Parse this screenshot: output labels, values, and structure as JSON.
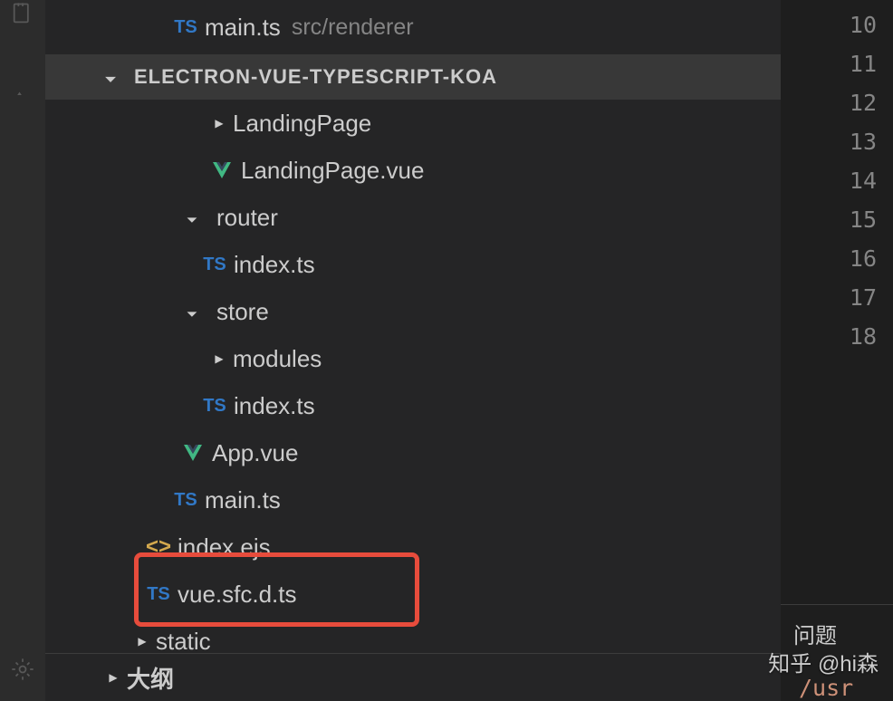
{
  "openEditors": {
    "file": {
      "icon": "TS",
      "name": "main.ts",
      "path": "src/renderer"
    }
  },
  "project": {
    "name": "ELECTRON-VUE-TYPESCRIPT-KOA"
  },
  "tree": [
    {
      "type": "folder",
      "expanded": false,
      "name": "LandingPage",
      "indent": 3
    },
    {
      "type": "file",
      "icon": "vue",
      "name": "LandingPage.vue",
      "indent": 3
    },
    {
      "type": "folder",
      "expanded": true,
      "name": "router",
      "indent": 2
    },
    {
      "type": "file",
      "icon": "TS",
      "name": "index.ts",
      "indent": 4
    },
    {
      "type": "folder",
      "expanded": true,
      "name": "store",
      "indent": 2
    },
    {
      "type": "folder",
      "expanded": false,
      "name": "modules",
      "indent": 3
    },
    {
      "type": "file",
      "icon": "TS",
      "name": "index.ts",
      "indent": 4
    },
    {
      "type": "file",
      "icon": "vue",
      "name": "App.vue",
      "indent": 5
    },
    {
      "type": "file",
      "icon": "TS",
      "name": "main.ts",
      "indent": 5
    },
    {
      "type": "file",
      "icon": "code",
      "name": "index.ejs",
      "indent": 6
    },
    {
      "type": "file",
      "icon": "TS",
      "name": "vue.sfc.d.ts",
      "indent": 6,
      "highlighted": true
    },
    {
      "type": "folder",
      "expanded": false,
      "name": "static",
      "indent": 7
    }
  ],
  "outline": {
    "label": "大纲"
  },
  "lineNumbers": [
    "10",
    "11",
    "12",
    "13",
    "14",
    "15",
    "16",
    "17",
    "18"
  ],
  "problems": {
    "tab": "问题",
    "text": "/usr"
  },
  "watermark": "知乎 @hi森"
}
